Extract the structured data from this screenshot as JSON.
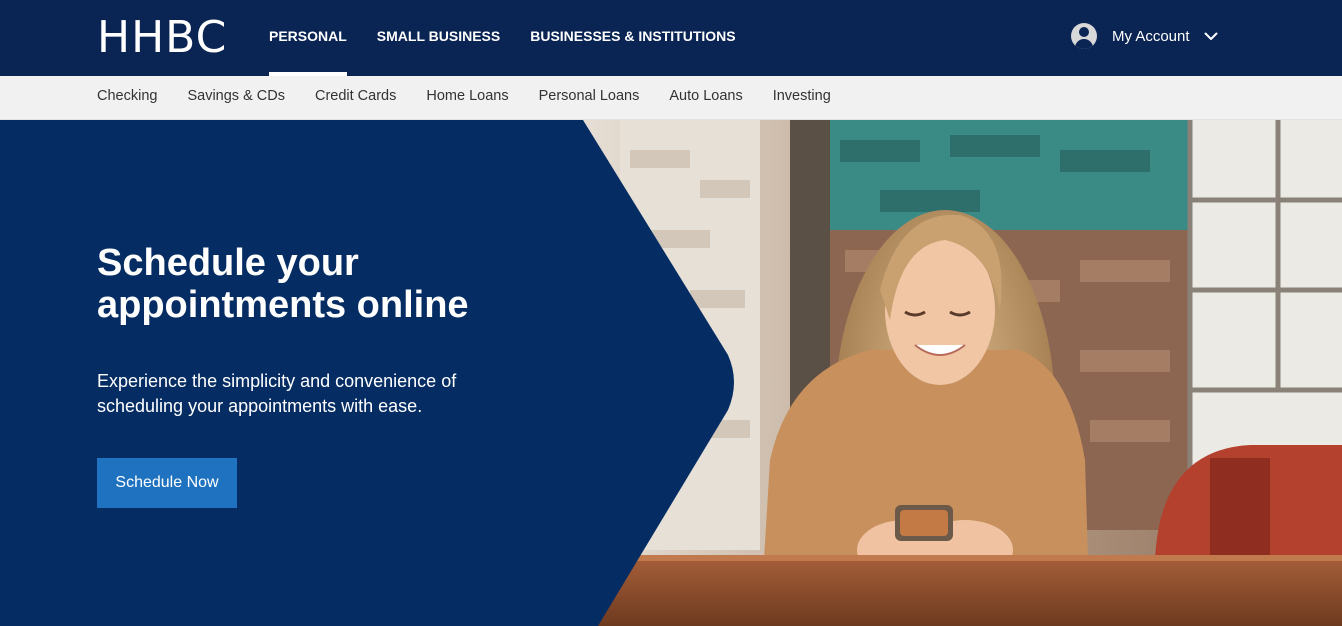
{
  "brand": {
    "logo_text": "HHBC"
  },
  "primary_nav": {
    "items": [
      {
        "label": "PERSONAL",
        "active": true
      },
      {
        "label": "SMALL BUSINESS",
        "active": false
      },
      {
        "label": "BUSINESSES & INSTITUTIONS",
        "active": false
      }
    ]
  },
  "account": {
    "label": "My Account",
    "avatar_icon": "user-avatar-icon",
    "chevron_icon": "chevron-down-icon"
  },
  "secondary_nav": {
    "items": [
      {
        "label": "Checking"
      },
      {
        "label": "Savings & CDs"
      },
      {
        "label": "Credit Cards"
      },
      {
        "label": "Home Loans"
      },
      {
        "label": "Personal Loans"
      },
      {
        "label": "Auto Loans"
      },
      {
        "label": "Investing"
      }
    ]
  },
  "hero": {
    "title": "Schedule your appointments online",
    "subtitle": "Experience the simplicity and convenience of scheduling your appointments with ease.",
    "button_label": "Schedule Now",
    "image_subject": "woman-smiling-at-phone-photo"
  },
  "colors": {
    "topbar": "#0a2453",
    "hero_panel": "#062d63",
    "subnav": "#f1f1f1",
    "button": "#1f72bf",
    "text_light": "#ffffff"
  }
}
